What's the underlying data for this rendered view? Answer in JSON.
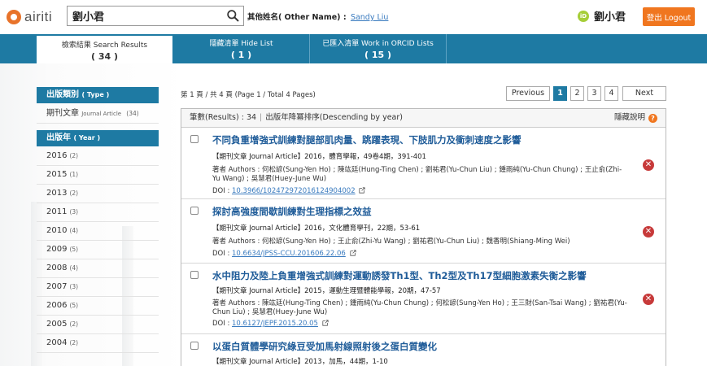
{
  "header": {
    "logo_text": "airiti",
    "search_value": "劉小君",
    "other_name_label": "其他姓名( Other Name) :",
    "other_name_value": "Sandy Liu",
    "orcid_badge": "iD",
    "user_name": "劉小君",
    "logout_label": "登出 Logout"
  },
  "tabs": [
    {
      "label": "檢索結果 Search Results",
      "count": "( 34 )"
    },
    {
      "label": "隱藏清單 Hide List",
      "count": "( 1 )"
    },
    {
      "label": "已匯入清單 Work in ORCID Lists",
      "count": "( 15 )"
    }
  ],
  "sidebar": {
    "type_header": "出版類別",
    "type_header_sub": "( Type )",
    "type_items": [
      {
        "label": "期刊文章",
        "sub": "Journal Article",
        "count": "(34)"
      }
    ],
    "year_header": "出版年",
    "year_header_sub": "( Year )",
    "years": [
      {
        "year": "2016",
        "count": "(2)"
      },
      {
        "year": "2015",
        "count": "(1)"
      },
      {
        "year": "2013",
        "count": "(2)"
      },
      {
        "year": "2011",
        "count": "(3)"
      },
      {
        "year": "2010",
        "count": "(4)"
      },
      {
        "year": "2009",
        "count": "(5)"
      },
      {
        "year": "2008",
        "count": "(4)"
      },
      {
        "year": "2007",
        "count": "(3)"
      },
      {
        "year": "2006",
        "count": "(5)"
      },
      {
        "year": "2005",
        "count": "(2)"
      },
      {
        "year": "2004",
        "count": "(2)"
      }
    ]
  },
  "pagination": {
    "info": "第 1 頁 / 共 4 頁 (Page 1 / Total 4 Pages)",
    "previous": "Previous",
    "pages": [
      "1",
      "2",
      "3",
      "4"
    ],
    "next": "Next"
  },
  "results": {
    "count_label": "筆數(Results) : 34",
    "sort_label": "出版年降冪排序(Descending by year)",
    "hide_help": "隱藏說明",
    "items": [
      {
        "title": "不同負重增強式訓練對腿部肌肉量、跳躍表現、下肢肌力及衝刺速度之影響",
        "meta": "【期刊文章 Journal Article】2016，體育學報，49卷4期，391-401",
        "authors": "著者 Authors : 何松諺(Sung-Yen Ho) ; 陳竑廷(Hung-Ting Chen) ; 劉祐君(Yu-Chun Liu) ; 鍾雨純(Yu-Chun Chung) ; 王止俞(Zhi-Yu Wang) ; 吳慧君(Huey-June Wu)",
        "doi_label": "DOI :",
        "doi": "10.3966/102472972016124904002"
      },
      {
        "title": "探討高強度間歇訓練對生理指標之效益",
        "meta": "【期刊文章 Journal Article】2016，文化體育學刊，22期，53-61",
        "authors": "著者 Authors : 何松諺(Sung-Yen Ho) ; 王止俞(Zhi-Yu Wang) ; 劉祐君(Yu-Chun Liu) ; 魏香明(Shiang-Ming Wei)",
        "doi_label": "DOI :",
        "doi": "10.6634/JPSS-CCU.201606.22.06"
      },
      {
        "title": "水中阻力及陸上負重增強式訓練對運動誘發Th1型、Th2型及Th17型細胞激素失衡之影響",
        "meta": "【期刊文章 Journal Article】2015，運動生理暨體能學報，20期，47-57",
        "authors": "著者 Authors : 陳竑廷(Hung-Ting Chen) ; 鍾雨純(Yu-Chun Chung) ; 何松諺(Sung-Yen Ho) ; 王三財(San-Tsai Wang) ; 劉祐君(Yu-Chun Liu) ; 吳慧君(Huey-June Wu)",
        "doi_label": "DOI :",
        "doi": "10.6127/JEPF.2015.20.05"
      },
      {
        "title": "以蛋白質體學研究綠豆受加馬射線照射後之蛋白質變化",
        "meta": "【期刊文章 Journal Article】2013，加馬，44期，1-10"
      }
    ]
  }
}
